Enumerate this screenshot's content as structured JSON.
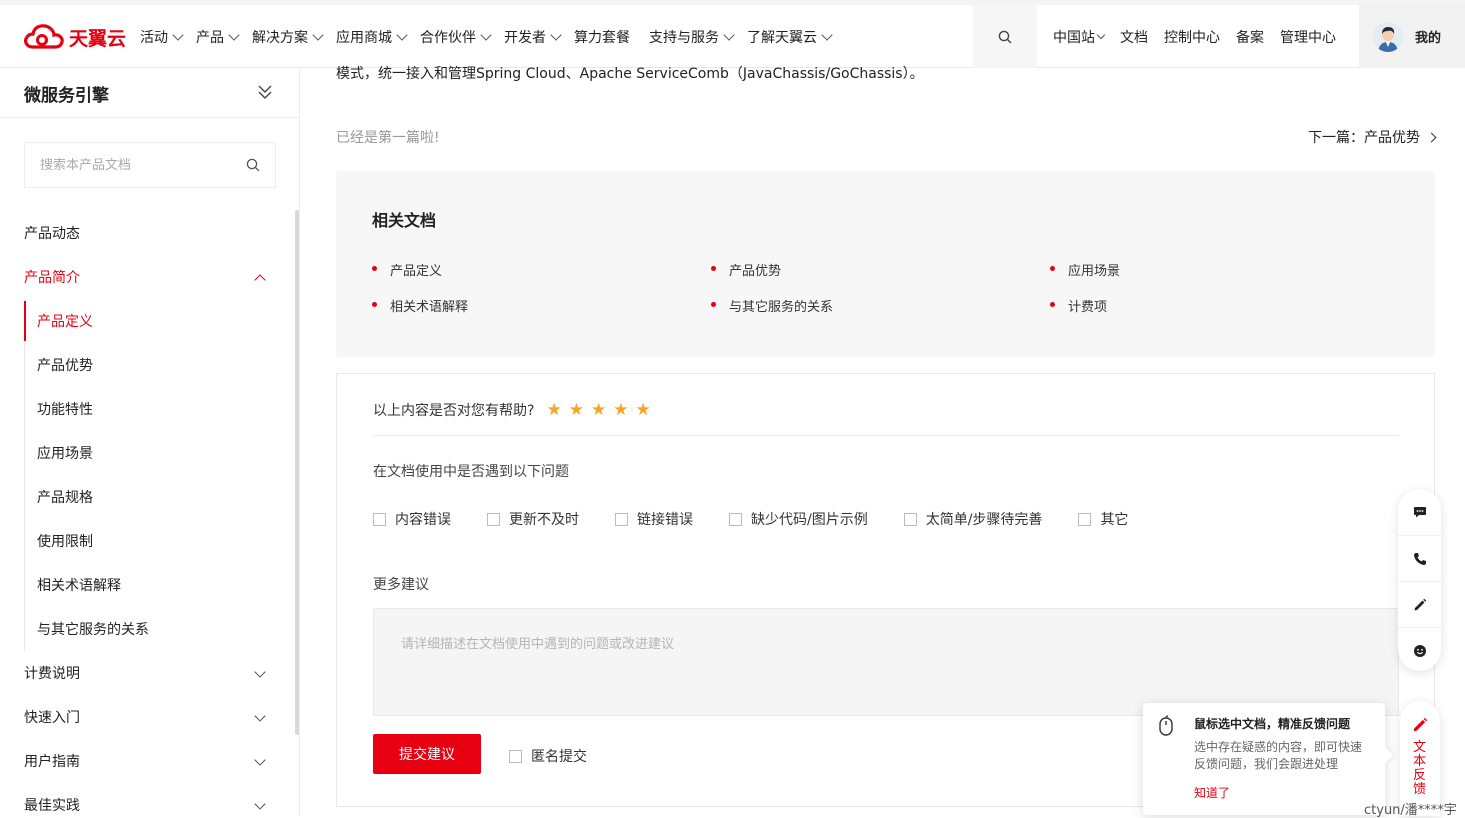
{
  "header": {
    "logo_text": "天翼云",
    "nav": [
      {
        "label": "活动",
        "chevron": true
      },
      {
        "label": "产品",
        "chevron": true
      },
      {
        "label": "解决方案",
        "chevron": true
      },
      {
        "label": "应用商城",
        "chevron": true
      },
      {
        "label": "合作伙伴",
        "chevron": true
      },
      {
        "label": "开发者",
        "chevron": true
      },
      {
        "label": "算力套餐",
        "chevron": false
      },
      {
        "label": "支持与服务",
        "chevron": true
      },
      {
        "label": "了解天翼云",
        "chevron": true
      }
    ],
    "right_links": [
      "中国站",
      "文档",
      "控制中心",
      "备案",
      "管理中心"
    ],
    "user_label": "我的",
    "brand_color": "#e60012"
  },
  "sidebar": {
    "title": "微服务引擎",
    "search_placeholder": "搜索本产品文档",
    "menu": {
      "product_news": "产品动态",
      "product_intro": "产品简介",
      "sub": [
        "产品定义",
        "产品优势",
        "功能特性",
        "应用场景",
        "产品规格",
        "使用限制",
        "相关术语解释",
        "与其它服务的关系"
      ],
      "billing": "计费说明",
      "quick_start": "快速入门",
      "user_guide": "用户指南",
      "best_practice": "最佳实践"
    }
  },
  "main": {
    "intro_line": "模式，统一接入和管理Spring Cloud、Apache ServiceComb（JavaChassis/GoChassis）。",
    "prev_text": "已经是第一篇啦!",
    "next_label": "下一篇：产品优势",
    "related": {
      "title": "相关文档",
      "items": [
        "产品定义",
        "产品优势",
        "应用场景",
        "相关术语解释",
        "与其它服务的关系",
        "计费项"
      ]
    },
    "feedback": {
      "question": "以上内容是否对您有帮助?",
      "rating_stars": 5,
      "issues_label": "在文档使用中是否遇到以下问题",
      "issues": [
        "内容错误",
        "更新不及时",
        "链接错误",
        "缺少代码/图片示例",
        "太简单/步骤待完善",
        "其它"
      ],
      "more_label": "更多建议",
      "textarea_placeholder": "请详细描述在文档使用中遇到的问题或改进建议",
      "submit_label": "提交建议",
      "anonymous_label": "匿名提交"
    }
  },
  "float_bar": {
    "icons": [
      "chat-icon",
      "phone-icon",
      "pencil-icon",
      "smile-icon"
    ]
  },
  "tooltip": {
    "title": "鼠标选中文档，精准反馈问题",
    "body": "选中存在疑惑的内容，即可快速反馈问题，我们会跟进处理",
    "ok_label": "知道了"
  },
  "side_tab": {
    "label": "文本反馈"
  },
  "watermark": "ctyun/潘****宇"
}
